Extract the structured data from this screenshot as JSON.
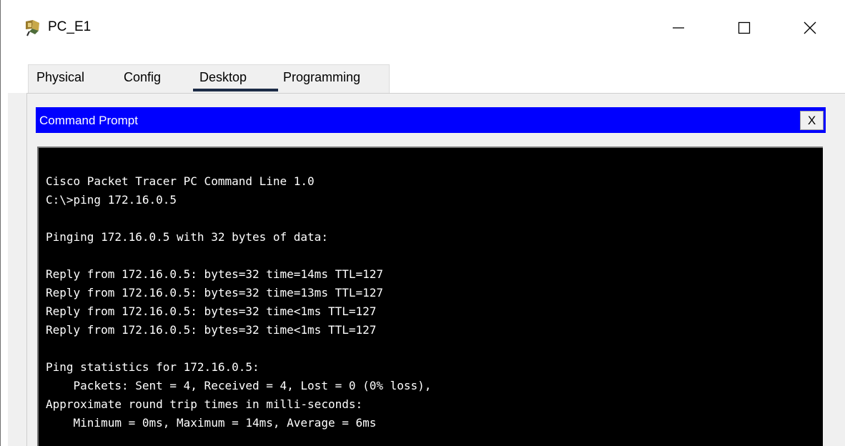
{
  "window": {
    "title": "PC_E1",
    "minimize_glyph": "—",
    "maximize_glyph": "☐",
    "close_glyph": "✕"
  },
  "tabs": [
    {
      "label": "Physical"
    },
    {
      "label": "Config"
    },
    {
      "label": "Desktop"
    },
    {
      "label": "Programming"
    }
  ],
  "active_tab": "Desktop",
  "command_prompt": {
    "title": "Command Prompt",
    "close_label": "X"
  },
  "terminal": {
    "lines": [
      "Cisco Packet Tracer PC Command Line 1.0",
      "C:\\>ping 172.16.0.5",
      "",
      "Pinging 172.16.0.5 with 32 bytes of data:",
      "",
      "Reply from 172.16.0.5: bytes=32 time=14ms TTL=127",
      "Reply from 172.16.0.5: bytes=32 time=13ms TTL=127",
      "Reply from 172.16.0.5: bytes=32 time<1ms TTL=127",
      "Reply from 172.16.0.5: bytes=32 time<1ms TTL=127",
      "",
      "Ping statistics for 172.16.0.5:",
      "    Packets: Sent = 4, Received = 4, Lost = 0 (0% loss),",
      "Approximate round trip times in milli-seconds:",
      "    Minimum = 0ms, Maximum = 14ms, Average = 6ms"
    ]
  },
  "colors": {
    "cmd_header_bg": "#0000ff",
    "terminal_bg": "#000000",
    "terminal_fg": "#ffffff",
    "tab_underline": "#1c2b46"
  },
  "icons": {
    "app": "packet-tracer-pc-icon"
  }
}
